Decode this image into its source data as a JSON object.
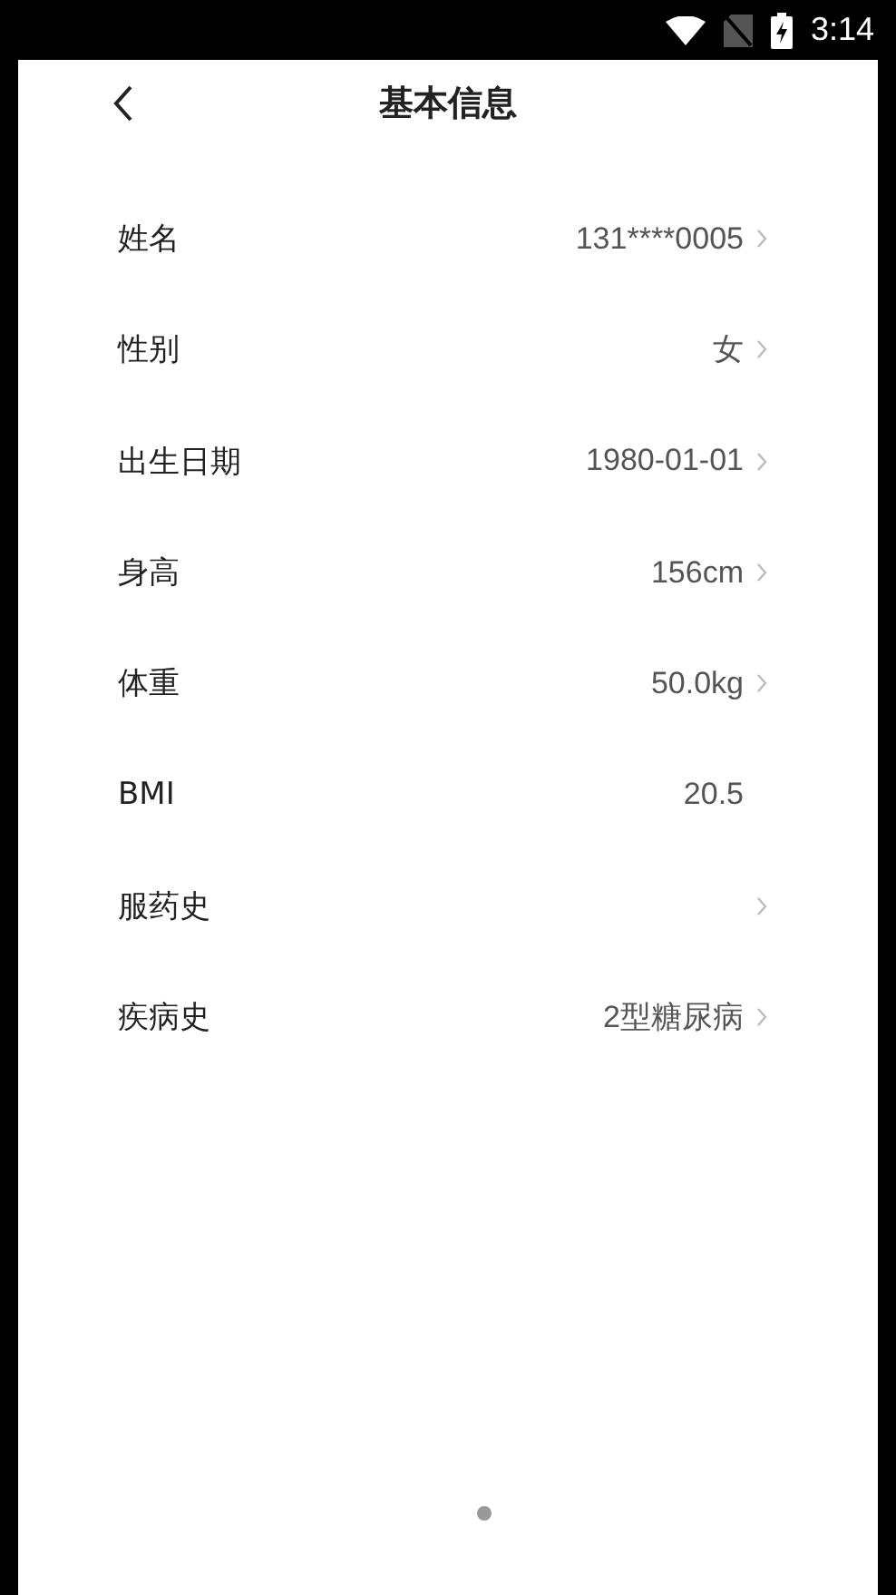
{
  "status_bar": {
    "time": "3:14"
  },
  "header": {
    "title": "基本信息"
  },
  "rows": [
    {
      "label": "姓名",
      "value": "131****0005",
      "chevron": true
    },
    {
      "label": "性别",
      "value": "女",
      "chevron": true
    },
    {
      "label": "出生日期",
      "value": "1980-01-01",
      "chevron": true
    },
    {
      "label": "身高",
      "value": "156cm",
      "chevron": true
    },
    {
      "label": "体重",
      "value": "50.0kg",
      "chevron": true
    },
    {
      "label": "BMI",
      "value": "20.5",
      "chevron": false
    },
    {
      "label": "服药史",
      "chevron": true
    },
    {
      "label": "疾病史",
      "value": "2型糖尿病",
      "chevron": true
    }
  ]
}
